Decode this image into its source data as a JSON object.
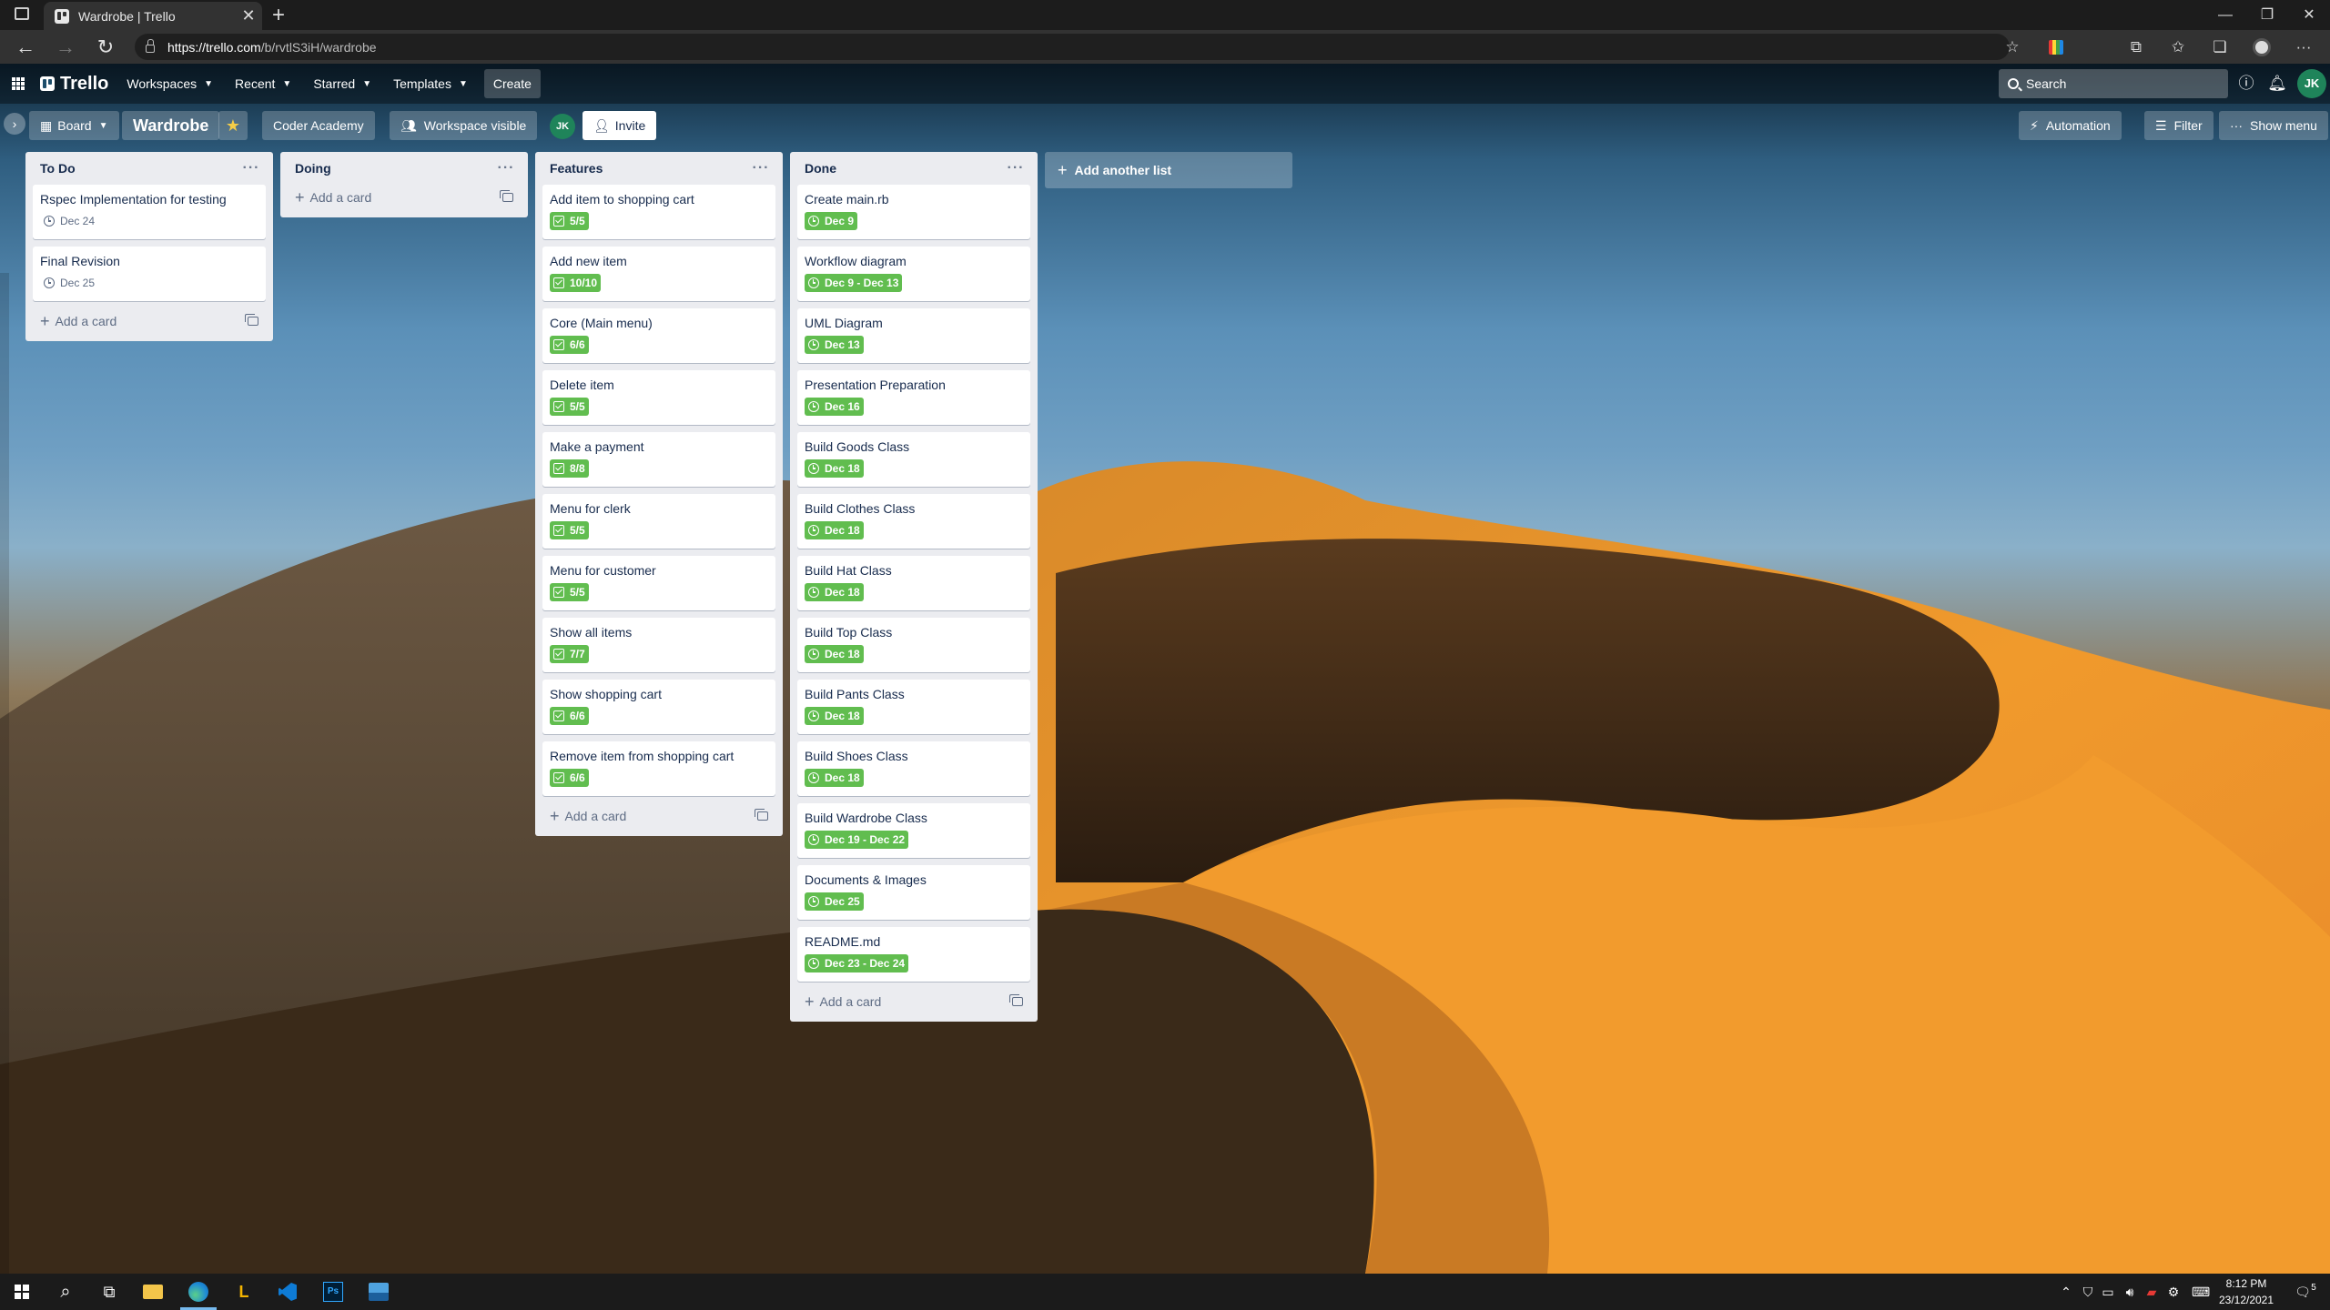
{
  "browser": {
    "tab_title": "Wardrobe | Trello",
    "tab_close": "✕",
    "new_tab": "+",
    "url_host": "https://trello.com",
    "url_path": "/b/rvtlS3iH/wardrobe",
    "window_controls": [
      "—",
      "❐",
      "✕"
    ]
  },
  "trello_header": {
    "logo": "Trello",
    "menu": [
      {
        "label": "Workspaces"
      },
      {
        "label": "Recent"
      },
      {
        "label": "Starred"
      },
      {
        "label": "Templates"
      }
    ],
    "create_label": "Create",
    "search_placeholder": "Search",
    "avatar_initials": "JK"
  },
  "board_header": {
    "view_label": "Board",
    "board_name": "Wardrobe",
    "workspace_name": "Coder Academy",
    "visibility_label": "Workspace visible",
    "member_initials": "JK",
    "invite_label": "Invite",
    "automation_label": "Automation",
    "filter_label": "Filter",
    "show_menu_label": "Show menu"
  },
  "lists": [
    {
      "name": "To Do",
      "cards": [
        {
          "title": "Rspec Implementation for testing",
          "badge": "Dec 24",
          "badge_type": "date",
          "complete": false
        },
        {
          "title": "Final Revision",
          "badge": "Dec 25",
          "badge_type": "date",
          "complete": false
        }
      ],
      "add_label": "Add a card"
    },
    {
      "name": "Doing",
      "cards": [],
      "add_label": "Add a card"
    },
    {
      "name": "Features",
      "cards": [
        {
          "title": "Add item to shopping cart",
          "badge": "5/5",
          "badge_type": "checklist",
          "complete": true
        },
        {
          "title": "Add new item",
          "badge": "10/10",
          "badge_type": "checklist",
          "complete": true
        },
        {
          "title": "Core (Main menu)",
          "badge": "6/6",
          "badge_type": "checklist",
          "complete": true
        },
        {
          "title": "Delete item",
          "badge": "5/5",
          "badge_type": "checklist",
          "complete": true
        },
        {
          "title": "Make a payment",
          "badge": "8/8",
          "badge_type": "checklist",
          "complete": true
        },
        {
          "title": "Menu for clerk",
          "badge": "5/5",
          "badge_type": "checklist",
          "complete": true
        },
        {
          "title": "Menu for customer",
          "badge": "5/5",
          "badge_type": "checklist",
          "complete": true
        },
        {
          "title": "Show all items",
          "badge": "7/7",
          "badge_type": "checklist",
          "complete": true
        },
        {
          "title": "Show shopping cart",
          "badge": "6/6",
          "badge_type": "checklist",
          "complete": true
        },
        {
          "title": "Remove item from shopping cart",
          "badge": "6/6",
          "badge_type": "checklist",
          "complete": true
        }
      ],
      "add_label": "Add a card"
    },
    {
      "name": "Done",
      "cards": [
        {
          "title": "Create main.rb",
          "badge": "Dec 9",
          "badge_type": "date",
          "complete": true
        },
        {
          "title": "Workflow diagram",
          "badge": "Dec 9 - Dec 13",
          "badge_type": "date",
          "complete": true
        },
        {
          "title": "UML Diagram",
          "badge": "Dec 13",
          "badge_type": "date",
          "complete": true
        },
        {
          "title": "Presentation Preparation",
          "badge": "Dec 16",
          "badge_type": "date",
          "complete": true
        },
        {
          "title": "Build Goods Class",
          "badge": "Dec 18",
          "badge_type": "date",
          "complete": true
        },
        {
          "title": "Build Clothes Class",
          "badge": "Dec 18",
          "badge_type": "date",
          "complete": true
        },
        {
          "title": "Build Hat Class",
          "badge": "Dec 18",
          "badge_type": "date",
          "complete": true
        },
        {
          "title": "Build Top Class",
          "badge": "Dec 18",
          "badge_type": "date",
          "complete": true
        },
        {
          "title": "Build Pants Class",
          "badge": "Dec 18",
          "badge_type": "date",
          "complete": true
        },
        {
          "title": "Build Shoes Class",
          "badge": "Dec 18",
          "badge_type": "date",
          "complete": true
        },
        {
          "title": "Build Wardrobe Class",
          "badge": "Dec 19 - Dec 22",
          "badge_type": "date",
          "complete": true
        },
        {
          "title": "Documents & Images",
          "badge": "Dec 25",
          "badge_type": "date",
          "complete": true
        },
        {
          "title": "README.md",
          "badge": "Dec 23 - Dec 24",
          "badge_type": "date",
          "complete": true
        }
      ],
      "add_label": "Add a card"
    }
  ],
  "add_list_label": "Add another list",
  "taskbar": {
    "time": "8:12 PM",
    "date": "23/12/2021",
    "notification_count": "5"
  },
  "colors": {
    "complete_badge": "#61bd4f",
    "list_bg": "#ebecf0",
    "avatar": "#1f845a"
  }
}
